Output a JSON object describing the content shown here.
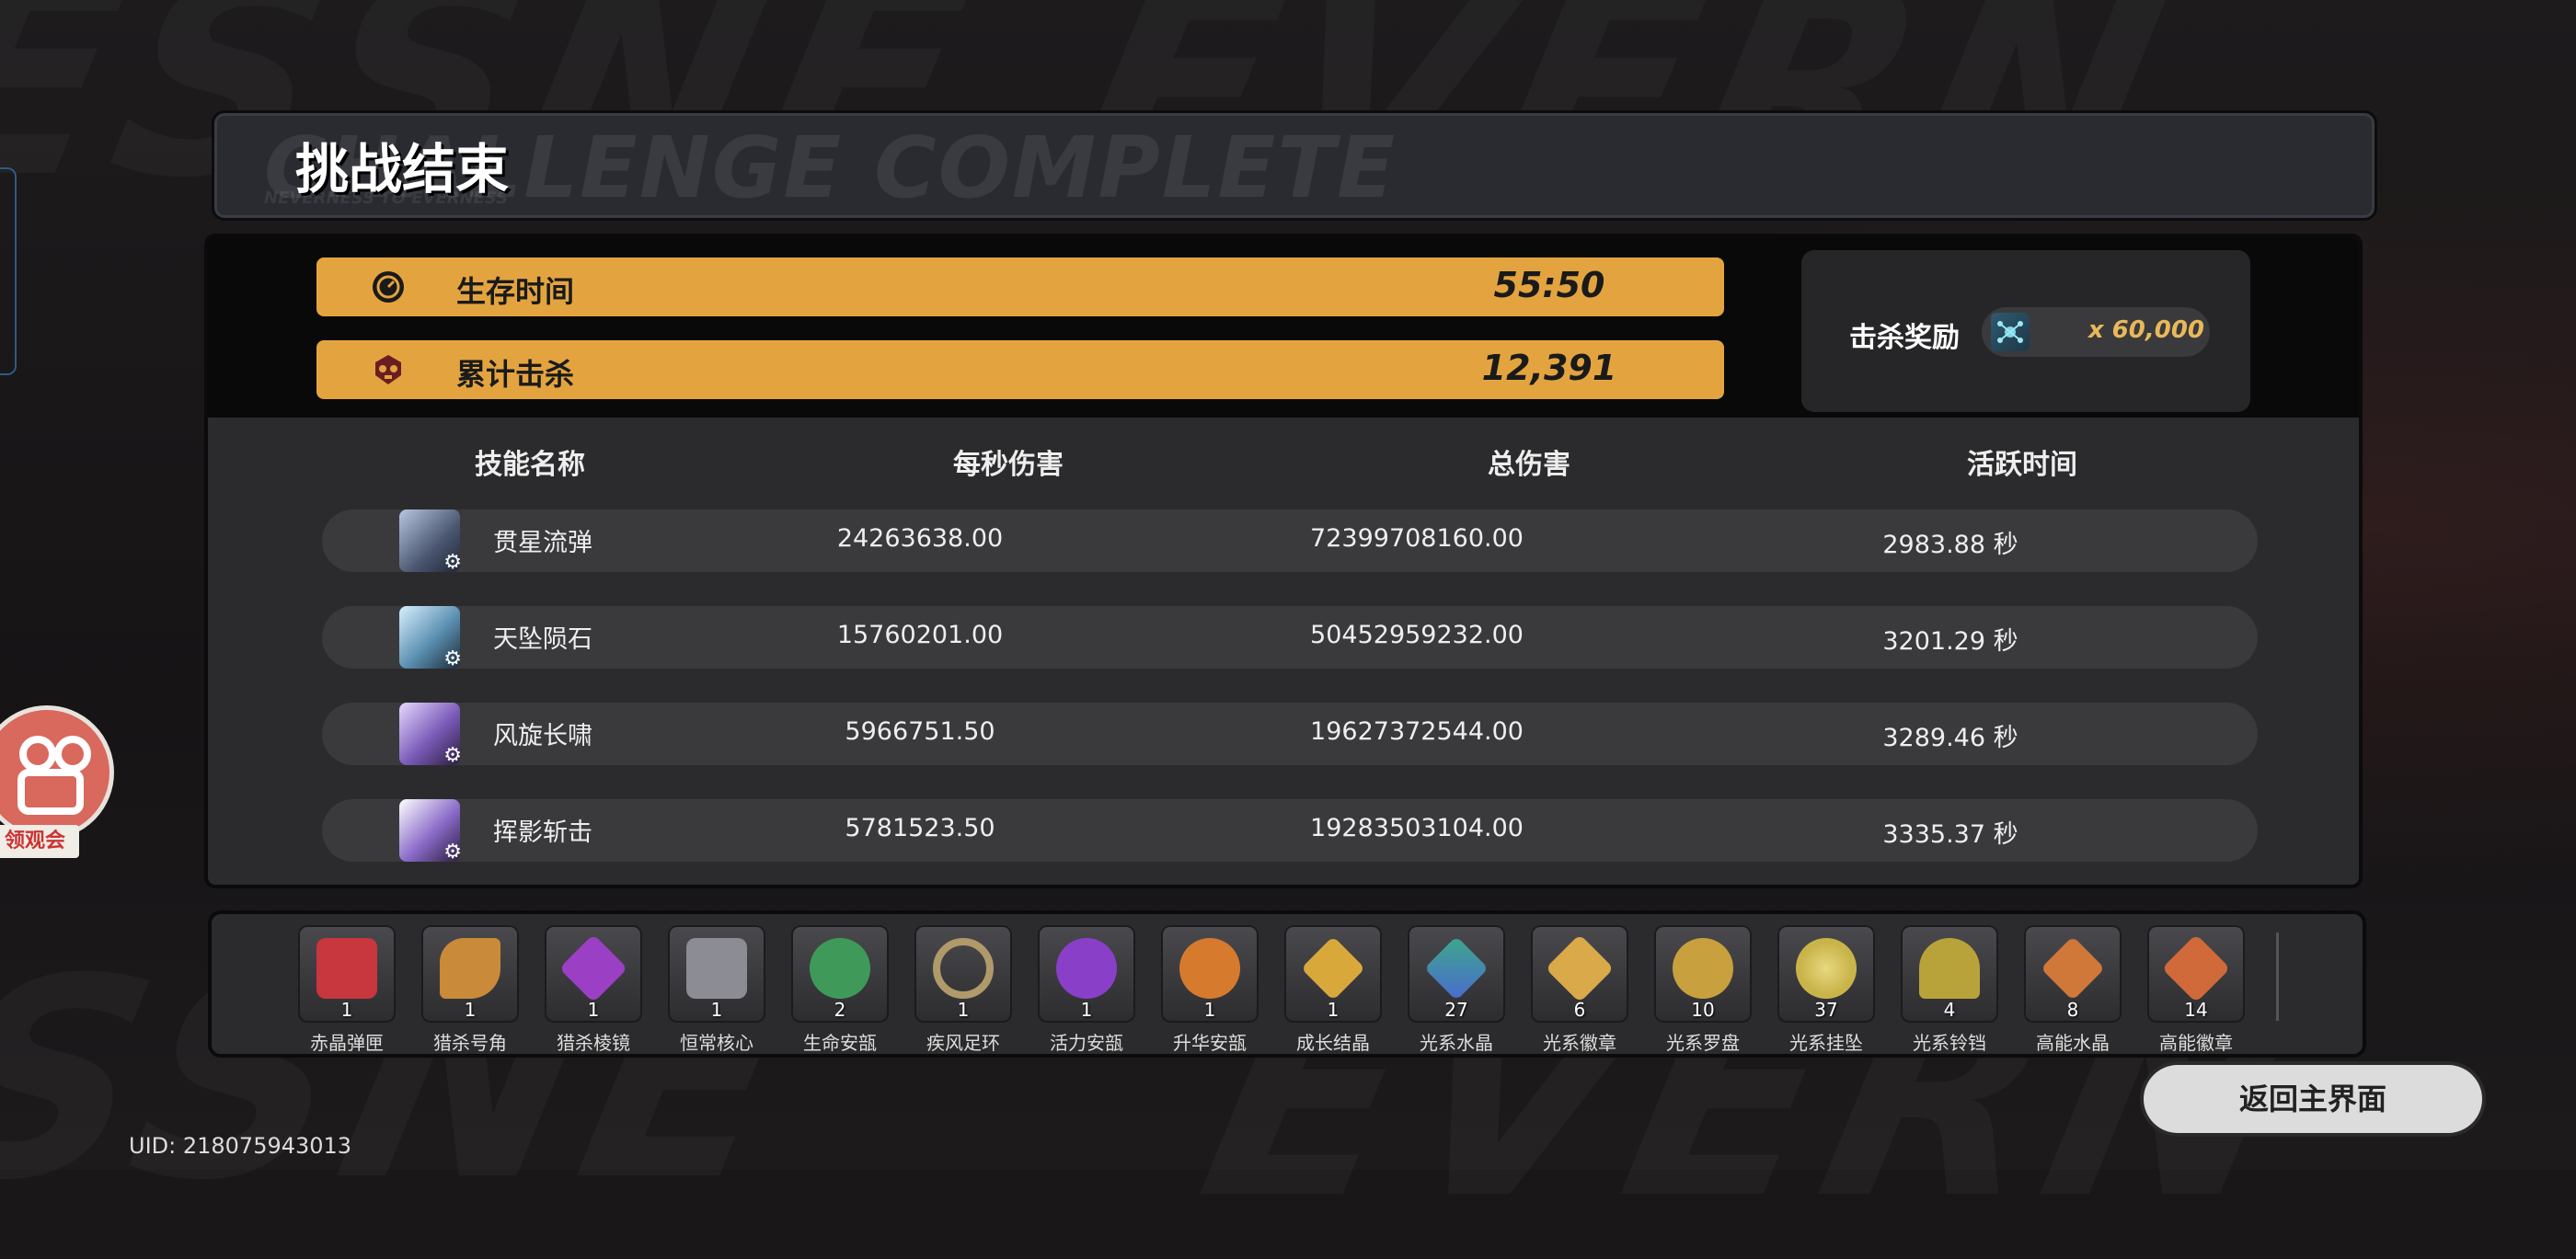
{
  "header": {
    "title": "挑战结束",
    "bg_text": "CHALLENGE COMPLETE",
    "bg_subtext": "NEVERNESS TO EVERNESS"
  },
  "stats": [
    {
      "icon": "timer-icon",
      "label": "生存时间",
      "value": "55:50"
    },
    {
      "icon": "kill-skull-icon",
      "label": "累计击杀",
      "value": "12,391"
    }
  ],
  "reward": {
    "label": "击杀奖励",
    "icon": "crystal-currency-icon",
    "value": "x 60,000"
  },
  "table": {
    "columns": [
      "技能名称",
      "每秒伤害",
      "总伤害",
      "活跃时间"
    ],
    "rows": [
      {
        "icon": "piercing-star-skill-icon",
        "name": "贯星流弹",
        "dps": "24263638.00",
        "total": "72399708160.00",
        "time": "2983.88 秒"
      },
      {
        "icon": "meteor-skill-icon",
        "name": "天坠陨石",
        "dps": "15760201.00",
        "total": "50452959232.00",
        "time": "3201.29 秒"
      },
      {
        "icon": "whirlwind-skill-icon",
        "name": "风旋长啸",
        "dps": "5966751.50",
        "total": "19627372544.00",
        "time": "3289.46 秒"
      },
      {
        "icon": "shadow-slash-skill-icon",
        "name": "挥影斩击",
        "dps": "5781523.50",
        "total": "19283503104.00",
        "time": "3335.37 秒"
      }
    ]
  },
  "items": [
    {
      "name": "赤晶弹匣",
      "count": "1",
      "color": "#c8363e",
      "icon": "red-crystal-case-icon"
    },
    {
      "name": "猎杀号角",
      "count": "1",
      "color": "#c98a3a",
      "icon": "hunting-horn-icon"
    },
    {
      "name": "猎杀棱镜",
      "count": "1",
      "color": "#9b3fc4",
      "icon": "purple-prism-icon"
    },
    {
      "name": "恒常核心",
      "count": "1",
      "color": "#8c8c94",
      "icon": "steel-core-icon"
    },
    {
      "name": "生命安瓿",
      "count": "2",
      "color": "#3f9a5a",
      "icon": "green-potion-icon"
    },
    {
      "name": "疾风足环",
      "count": "1",
      "color": "#b09a6a",
      "icon": "winged-ring-icon"
    },
    {
      "name": "活力安瓿",
      "count": "1",
      "color": "#8a3fc8",
      "icon": "purple-potion-icon"
    },
    {
      "name": "升华安瓿",
      "count": "1",
      "color": "#d67a2e",
      "icon": "orange-potion-icon"
    },
    {
      "name": "成长结晶",
      "count": "1",
      "color": "#d8a93a",
      "icon": "gold-crystal-icon"
    },
    {
      "name": "光系水晶",
      "count": "27",
      "color": "#3ea88a",
      "icon": "light-crystal-icon"
    },
    {
      "name": "光系徽章",
      "count": "6",
      "color": "#d9a94a",
      "icon": "light-badge-icon"
    },
    {
      "name": "光系罗盘",
      "count": "10",
      "color": "#c9a03e",
      "icon": "light-compass-icon"
    },
    {
      "name": "光系挂坠",
      "count": "37",
      "color": "#c9b44a",
      "icon": "light-pendant-icon"
    },
    {
      "name": "光系铃铛",
      "count": "4",
      "color": "#b8a33a",
      "icon": "light-bell-icon"
    },
    {
      "name": "高能水晶",
      "count": "8",
      "color": "#d0773a",
      "icon": "energy-crystal-icon"
    },
    {
      "name": "高能徽章",
      "count": "14",
      "color": "#d06a3a",
      "icon": "energy-badge-icon"
    }
  ],
  "return_button": "返回主界面",
  "uid": "UID: 218075943013",
  "side_badge": "领观会"
}
